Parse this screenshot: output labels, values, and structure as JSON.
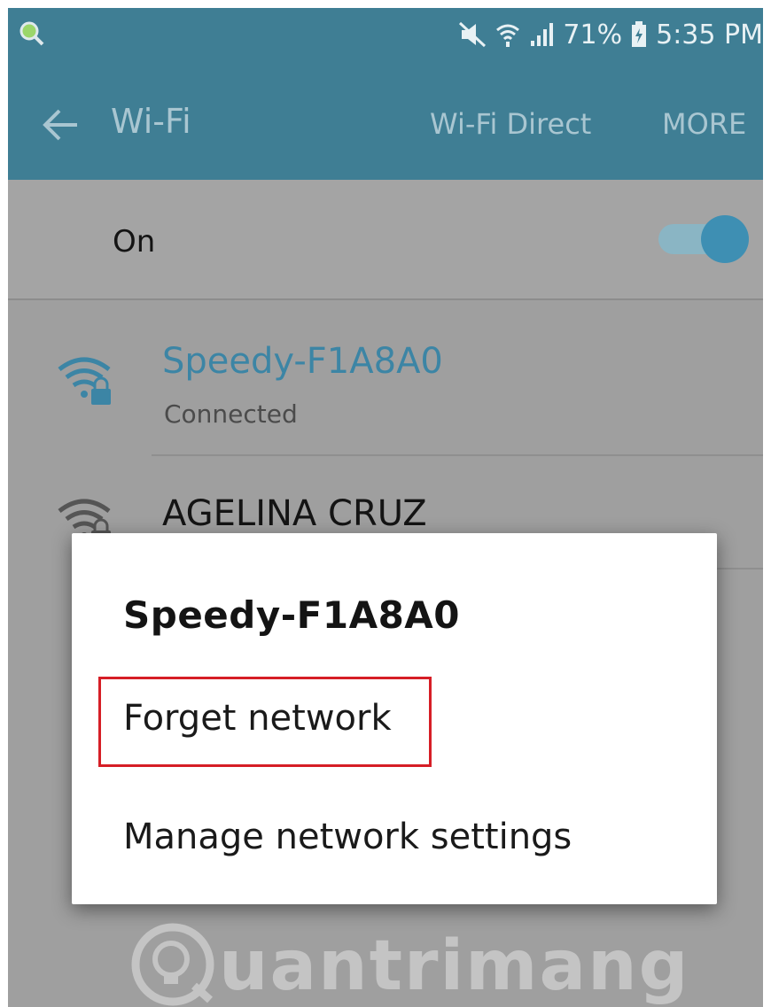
{
  "status_bar": {
    "battery_percent": "71%",
    "time": "5:35 PM",
    "icons": [
      "search-icon",
      "mute-icon",
      "wifi-signal-icon",
      "cell-signal-icon",
      "battery-charging-icon"
    ]
  },
  "app_bar": {
    "title": "Wi-Fi",
    "wifi_direct_label": "Wi-Fi Direct",
    "more_label": "MORE"
  },
  "wifi_toggle": {
    "label": "On",
    "enabled": true
  },
  "networks": [
    {
      "ssid": "Speedy-F1A8A0",
      "status": "Connected",
      "secured": true
    },
    {
      "ssid": "AGELINA CRUZ",
      "secured": true
    }
  ],
  "dialog": {
    "title": "Speedy-F1A8A0",
    "items": [
      "Forget network",
      "Manage network settings"
    ],
    "highlighted_item": "Forget network"
  },
  "watermark": {
    "text": "uantrimang"
  },
  "colors": {
    "app_bar": "#3f7e94",
    "accent": "#3e8fb3",
    "highlight_box": "#d61e26"
  }
}
